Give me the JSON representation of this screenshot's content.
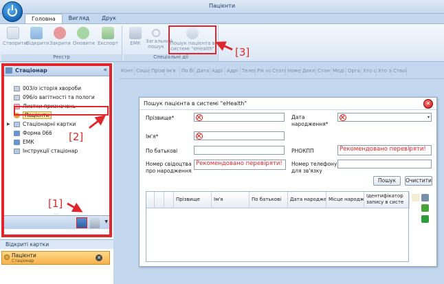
{
  "window": {
    "title": "Пацієнти"
  },
  "tabs": [
    {
      "label": "Головна",
      "active": true
    },
    {
      "label": "Вигляд",
      "active": false
    },
    {
      "label": "Друк",
      "active": false
    }
  ],
  "ribbon": {
    "groups": [
      {
        "label": "Реєстр"
      },
      {
        "label": "Спеціальні дії"
      }
    ],
    "buttons": {
      "create": "Створити",
      "open": "Відкрити",
      "close": "Закрити",
      "refresh": "Оновити",
      "export": "Експорт",
      "emk": "ЕМК",
      "general_search_1": "Загальний",
      "general_search_2": "пошук",
      "ehealth_search_1": "Пошук пацієнта в",
      "ehealth_search_2": "системі \"eHealth\""
    }
  },
  "left_panel": {
    "header": "Стаціонар",
    "collapse_glyph": "«",
    "tree": [
      {
        "label": "003/о історія хвороби",
        "icon": "document-icon"
      },
      {
        "label": "096/о вагітності та пологи",
        "icon": "document-icon"
      },
      {
        "label": "Листки призначень",
        "icon": "pink-document-icon"
      },
      {
        "label": "Пацієнти",
        "icon": "patient-icon",
        "selected": true
      },
      {
        "label": "Стаціонарні картки",
        "icon": "cards-icon",
        "expandable": true
      },
      {
        "label": "Форма 066",
        "icon": "form-icon"
      },
      {
        "label": "ЕМК",
        "icon": "emk-icon"
      },
      {
        "label": "Інструкції стаціонар",
        "icon": "grid-icon"
      }
    ],
    "grip": "....",
    "open_cards_title": "Відкриті картки",
    "open_card": {
      "title": "Пацієнти",
      "subtitle": "Стаціонар"
    }
  },
  "grid_headers": [
    "Конт",
    "Соціа",
    "Прізв",
    "Ім'я",
    "По бі",
    "Дата",
    "Адрі",
    "Адрі",
    "Телеф",
    "Рік на",
    "Стать",
    "Номе",
    "Декл",
    "Стан",
    "Меді",
    "Орга",
    "Хто с",
    "Хто з",
    "Ствої"
  ],
  "dialog": {
    "title": "Пошук пацієнта в системі \"eHealth\"",
    "close_glyph": "✕",
    "labels": {
      "surname": "Прізвище*",
      "birth_date_1": "Дата",
      "birth_date_2": "народження*",
      "name": "Ім'я*",
      "patronymic": "По батькові",
      "rnokpp": "РНОКПП",
      "cert_1": "Номер свідоцтва",
      "cert_2": "про народження",
      "phone_1": "Номер телефону",
      "phone_2": "для зв'язку"
    },
    "warnings": {
      "rnokpp": "Рекомендовано перевіряти!",
      "certificate": "Рекомендовано перевіряти!"
    },
    "buttons": {
      "search": "Пошук",
      "clear": "Очистити"
    },
    "dropdown_glyph": "▾",
    "result_columns": [
      "Прізвище",
      "Ім'я",
      "По батькові",
      "Дата народже",
      "Місце народж",
      "Ідентифікатор запису в систе"
    ]
  },
  "annotations": [
    "[1]",
    "[2]",
    "[3]"
  ],
  "colors": {
    "highlight": "#e0262b",
    "accent": "#1468b8",
    "selected_bg": "#fbe3a4"
  }
}
